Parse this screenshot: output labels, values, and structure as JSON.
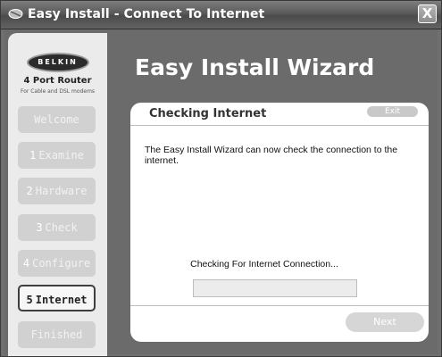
{
  "window": {
    "title": "Easy Install - Connect To Internet",
    "close_label": "X"
  },
  "sidebar": {
    "logo_text": "BELKIN",
    "product_name": "4 Port Router",
    "product_subtitle": "For Cable and DSL modems",
    "steps": [
      {
        "num": "",
        "label": "Welcome",
        "state": "disabled"
      },
      {
        "num": "1",
        "label": "Examine",
        "state": "disabled"
      },
      {
        "num": "2",
        "label": "Hardware",
        "state": "disabled"
      },
      {
        "num": "3",
        "label": "Check",
        "state": "disabled"
      },
      {
        "num": "4",
        "label": "Configure",
        "state": "disabled"
      },
      {
        "num": "5",
        "label": "Internet",
        "state": "active"
      },
      {
        "num": "",
        "label": "Finished",
        "state": "disabled"
      }
    ]
  },
  "main": {
    "heading": "Easy Install Wizard",
    "panel": {
      "title": "Checking Internet",
      "exit_label": "Exit",
      "description": "The Easy Install Wizard can now check the connection to the internet.",
      "status": "Checking For Internet Connection...",
      "progress_fraction": 0,
      "next_label": "Next"
    }
  },
  "colors": {
    "background": "#6b6b6b",
    "sidebar": "#ebebeb",
    "active_border": "#3e3e3e"
  }
}
